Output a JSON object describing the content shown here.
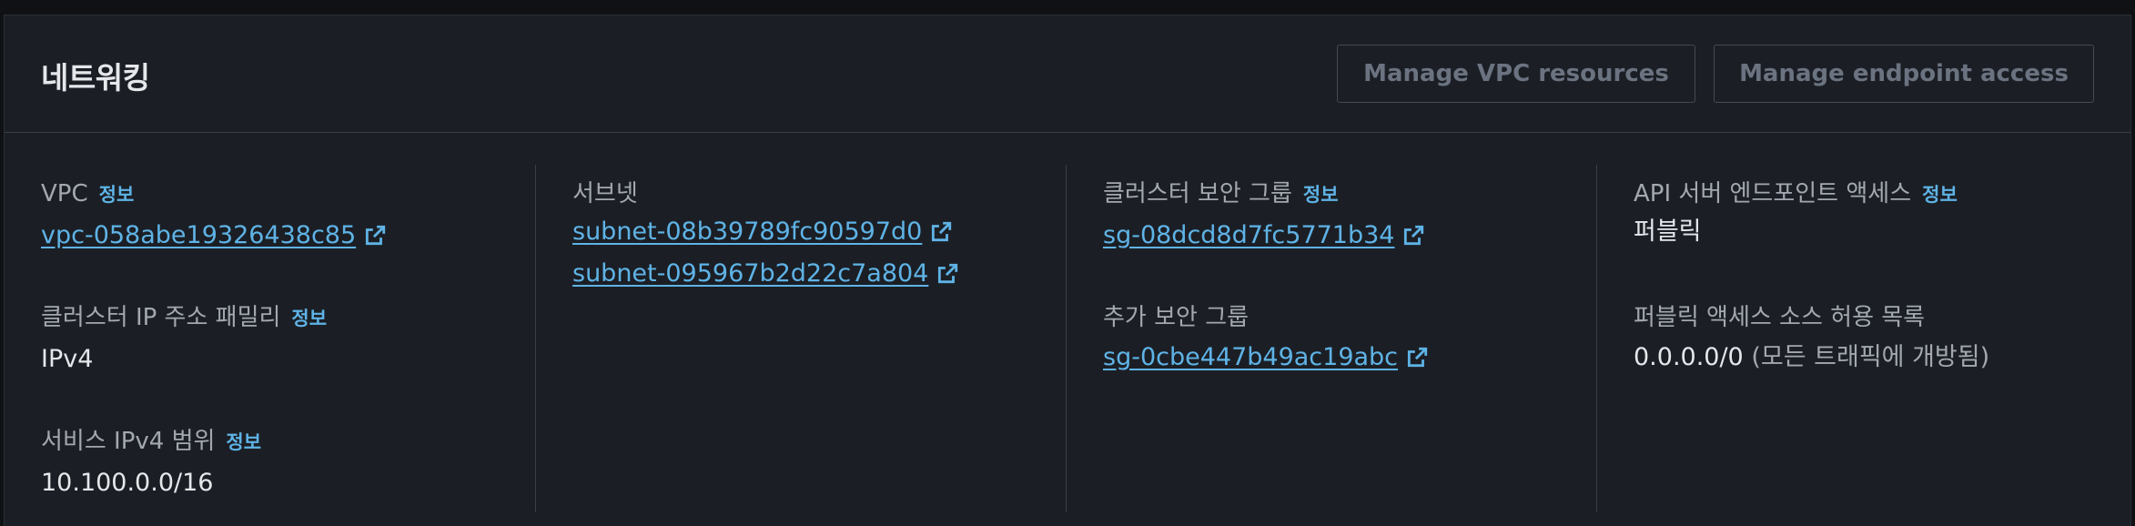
{
  "section": {
    "title": "네트워킹",
    "buttons": {
      "manage_vpc": "Manage VPC resources",
      "manage_endpoint": "Manage endpoint access"
    }
  },
  "info_link": "정보",
  "vpc": {
    "label": "VPC",
    "value": "vpc-058abe19326438c85"
  },
  "ip_family": {
    "label": "클러스터 IP 주소 패밀리",
    "value": "IPv4"
  },
  "service_range": {
    "label": "서비스 IPv4 범위",
    "value": "10.100.0.0/16"
  },
  "subnets": {
    "label": "서브넷",
    "items": [
      "subnet-08b39789fc90597d0",
      "subnet-095967b2d22c7a804"
    ]
  },
  "cluster_sg": {
    "label": "클러스터 보안 그룹",
    "value": "sg-08dcd8d7fc5771b34"
  },
  "additional_sg": {
    "label": "추가 보안 그룹",
    "value": "sg-0cbe447b49ac19abc"
  },
  "api_access": {
    "label": "API 서버 엔드포인트 액세스",
    "value": "퍼블릭"
  },
  "public_cidrs": {
    "label": "퍼블릭 액세스 소스 허용 목록",
    "value": "0.0.0.0/0",
    "note": "(모든 트래픽에 개방됨)"
  },
  "colors": {
    "background": "#1b1f25",
    "link": "#5fb3e6",
    "label": "#a3a8b0",
    "value": "#e5e7eb"
  },
  "icons": {
    "external_link": "external-link-icon"
  }
}
